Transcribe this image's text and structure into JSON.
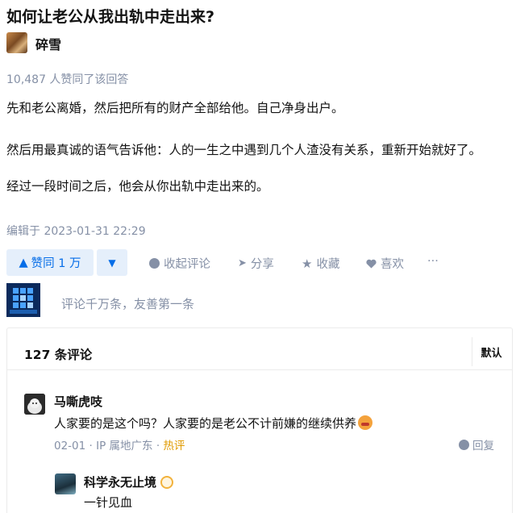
{
  "question": {
    "title": "如何让老公从我出轨中走出来?"
  },
  "answer": {
    "author": "碎雪",
    "likes_text": "10,487 人赞同了该回答",
    "paragraphs": [
      "先和老公离婚，然后把所有的财产全部给他。自己净身出户。",
      "然后用最真诚的语气告诉他：人的一生之中遇到几个人渣没有关系，重新开始就好了。",
      "经过一段时间之后，他会从你出轨中走出来的。"
    ],
    "edited": "编辑于 2023-01-31 22:29"
  },
  "actions": {
    "vote_up": "赞同 1 万",
    "collapse_comments": "收起评论",
    "share": "分享",
    "favorite": "收藏",
    "like": "喜欢",
    "more": "···"
  },
  "comment_box": {
    "placeholder": "评论千万条，友善第一条"
  },
  "comments": {
    "count_label": "127 条评论",
    "sort_label": "默认",
    "items": [
      {
        "name": "马嘶虎吱",
        "text": "人家要的是这个吗？人家要的是老公不计前嫌的继续供养",
        "date": "02-01",
        "ip": "IP 属地广东",
        "hot": "热评",
        "reply_label": "回复"
      }
    ],
    "reply": {
      "name": "科学永无止境",
      "text": "一针见血"
    }
  },
  "colors": {
    "accent": "#056de8",
    "muted": "#8590a6",
    "hot": "#e09a00"
  }
}
